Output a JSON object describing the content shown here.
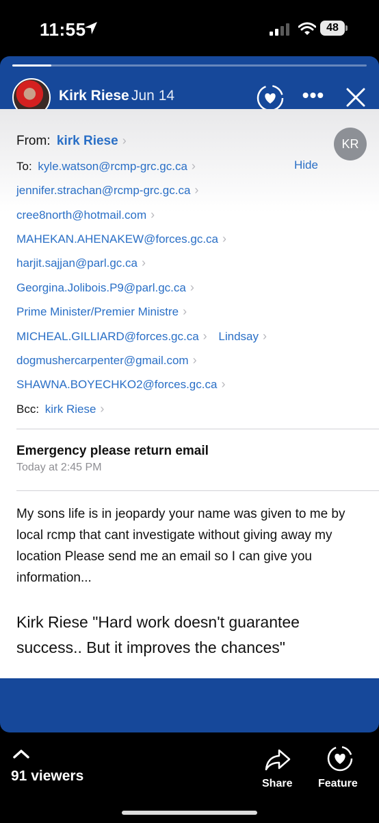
{
  "status_bar": {
    "time": "11:55",
    "battery": "48",
    "icons": [
      "location-arrow-icon",
      "signal-icon",
      "wifi-icon",
      "battery-icon"
    ]
  },
  "story": {
    "progress": 0.11,
    "author": "Kirk Riese",
    "date": "Jun 14",
    "more": "•••",
    "icons": [
      "heart-icon",
      "more-icon",
      "close-icon"
    ]
  },
  "email": {
    "from_label": "From:",
    "from_name": "kirk Riese",
    "avatar_initials": "KR",
    "to_label": "To:",
    "to_first": "kyle.watson@rcmp-grc.gc.ca",
    "hide_label": "Hide",
    "recipients": [
      "jennifer.strachan@rcmp-grc.gc.ca",
      "cree8north@hotmail.com",
      "MAHEKAN.AHENAKEW@forces.gc.ca",
      "harjit.sajjan@parl.gc.ca",
      "Georgina.Jolibois.P9@parl.gc.ca",
      "Prime Minister/Premier Ministre",
      "MICHEAL.GILLIARD@forces.gc.ca",
      "dogmushercarpenter@gmail.com",
      "SHAWNA.BOYECHKO2@forces.gc.ca"
    ],
    "extra_recipient": "Lindsay",
    "bcc_label": "Bcc:",
    "bcc_name": "kirk Riese",
    "subject": "Emergency please return email",
    "sent_time": "Today at 2:45 PM",
    "body": "My sons life is in jeopardy your name was given to me by local rcmp that cant investigate without giving away my location Please send me an email so I can give you information...",
    "signature": "Kirk Riese \"Hard work doesn't guarantee success.. But it improves the chances\"",
    "chevron": "›"
  },
  "bottom_bar": {
    "viewers": "91 viewers",
    "share_label": "Share",
    "feature_label": "Feature",
    "icons": [
      "chevron-up-icon",
      "share-icon",
      "feature-heart-icon"
    ]
  },
  "colors": {
    "story_blue": "#16489a",
    "link_blue": "#2a6fc6",
    "background": "#000000"
  }
}
